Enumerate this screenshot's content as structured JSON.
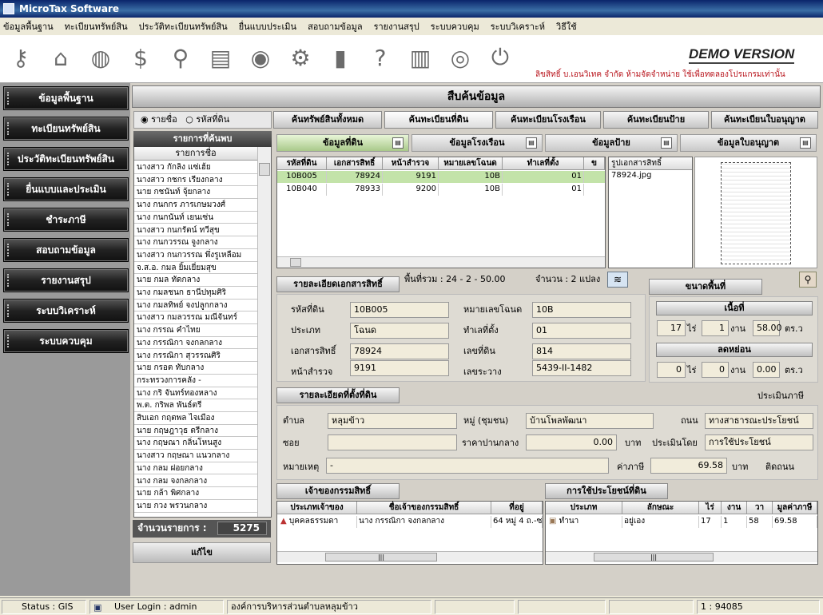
{
  "window": {
    "title": "MicroTax Software"
  },
  "menu": [
    "ข้อมูลพื้นฐาน",
    "ทะเบียนทรัพย์สิน",
    "ประวัติทะเบียนทรัพย์สิน",
    "ยื่นแบบประเมิน",
    "สอบถามข้อมูล",
    "รายงานสรุป",
    "ระบบควบคุม",
    "ระบบวิเคราะห์",
    "วิธีใช้"
  ],
  "toolbar": {
    "icons": [
      "key-icon",
      "house-icon",
      "globe-icon",
      "money-icon",
      "search-icon",
      "map-icon",
      "earth-icon",
      "gear-icon",
      "database-icon",
      "help-icon",
      "books-icon",
      "eye-icon",
      "power-icon"
    ],
    "demo": "DEMO VERSION",
    "copyright": "ลิขสิทธิ์ บ.เอนวิเทค จำกัด ห้ามจัดจำหน่าย ใช้เพื่อทดลองโปรแกรมเท่านั้น"
  },
  "nav": [
    "ข้อมูลพื้นฐาน",
    "ทะเบียนทรัพย์สิน",
    "ประวัติทะเบียนทรัพย์สิน",
    "ยื่นแบบและประเมิน",
    "ชำระภาษี",
    "สอบถามข้อมูล",
    "รายงานสรุป",
    "ระบบวิเคราะห์",
    "ระบบควบคุม"
  ],
  "main": {
    "title": "สืบค้นข้อมูล",
    "radio": {
      "opt1": "รายชื่อ",
      "opt2": "รหัสที่ดิน"
    },
    "tabs": [
      "ค้นทรัพย์สินทั้งหมด",
      "ค้นทะเบียนที่ดิน",
      "ค้นทะเบียนโรงเรือน",
      "ค้นทะเบียนป้าย",
      "ค้นทะเบียนใบอนุญาต"
    ],
    "subtabs": [
      "ข้อมูลที่ดิน",
      "ข้อมูลโรงเรือน",
      "ข้อมูลป้าย",
      "ข้อมูลใบอนุญาต"
    ]
  },
  "list": {
    "title": "รายการที่ค้นพบ",
    "col": "รายการชื่อ",
    "items": [
      "นางสาว กักลิง แซ่เฮ้ย",
      "นางสาว กชกร เรียงกลาง",
      "นาย กชนันท์ จุ้ยกลาง",
      "นาง กนกกร ภารเกษมวงศ์",
      "นาง กนกนันท์ เยนเซ่น",
      "นางสาว กนกรัตน์ ทวีสุข",
      "นาง กนกวรรณ จูงกลาง",
      "นางสาว กนกวรรณ พึ่งรูเหลือม",
      "จ.ส.อ. กมล ยิ้มเยี่ยมสุข",
      "นาย กมล ทัดกลาง",
      "นาง กมลชนก ธานีปทุมศิริ",
      "นาง กมลทิพย์ จงปลูกกลาง",
      "นางสาว กมลวรรณ มณีจันทร์",
      "นาง กรรณ คำไทย",
      "นาง กรรณิกา จงกลกลาง",
      "นาง กรรณิกา สุวรรณศิริ",
      "นาย กรอต ทับกลาง",
      "กระทรวงการคลัง -",
      "นาง กริ จันทร์ทองหลาง",
      "พ.ต. กริพล พันธ์ตรี",
      "สิบเอก กฤตพล ไจเมือง",
      "นาย กฤษฎาวุธ ตรีกลาง",
      "นาง กฤษณา กลิ่นโหนสูง",
      "นางสาว กฤษณา แนวกลาง",
      "นาง กลม ฝอยกลาง",
      "นาง กลม จงกลกลาง",
      "นาย กล้า พิศกลาง",
      "นาย กวง พรวนกลาง"
    ],
    "count_label": "จำนวนรายการ :",
    "count": "5275",
    "edit": "แก้ไข"
  },
  "landgrid": {
    "headers": [
      "รหัสที่ดิน",
      "เอกสารสิทธิ์",
      "หน้าสำรวจ",
      "หมายเลขโฉนด",
      "ทำเลที่ตั้ง",
      "ข"
    ],
    "rows": [
      [
        "10B005",
        "78924",
        "9191",
        "10B",
        "01"
      ],
      [
        "10B040",
        "78933",
        "9200",
        "10B",
        "01"
      ]
    ]
  },
  "docimg": {
    "header": "รูปเอกสารสิทธิ์",
    "file": "78924.jpg"
  },
  "area_info": {
    "label": "พื้นที่รวม :",
    "value": "24 - 2 - 50.00",
    "count_label": "จำนวน :",
    "count": "2 แปลง"
  },
  "detail": {
    "title": "รายละเอียดเอกสารสิทธิ์",
    "code_label": "รหัสที่ดิน",
    "code": "10B005",
    "type_label": "ประเภท",
    "type": "โฉนด",
    "doc_label": "เอกสารสิทธิ์",
    "doc": "78924",
    "survey_label": "หน้าสำรวจ",
    "survey": "9191",
    "deedno_label": "หมายเลขโฉนด",
    "deedno": "10B",
    "loc_label": "ทำเลที่ตั้ง",
    "loc": "01",
    "landno_label": "เลขที่ดิน",
    "landno": "814",
    "range_label": "เลขระวาง",
    "range": "5439-II-1482"
  },
  "area": {
    "title": "ขนาดพื้นที่",
    "gross": "เนื้อที่",
    "rai": "17",
    "ngan": "1",
    "wa": "58.00",
    "rai_u": "ไร่",
    "ngan_u": "งาน",
    "wa_u": "ตร.ว",
    "reduce": "ลดหย่อน",
    "r_rai": "0",
    "r_ngan": "0",
    "r_wa": "0.00"
  },
  "location": {
    "title": "รายละเอียดที่ตั้งที่ดิน",
    "assess": "ประเมินภาษี",
    "tambon_label": "ตำบล",
    "tambon": "หลุมข้าว",
    "moo_label": "หมู่ (ชุมชน)",
    "moo": "บ้านโพลพัฒนา",
    "road_label": "ถนน",
    "road": "ทางสาธารณะประโยชน์",
    "soi_label": "ซอย",
    "soi": "",
    "price_label": "ราคาปานกลาง",
    "price": "0.00",
    "baht": "บาท",
    "assessby_label": "ประเมินโดย",
    "assessby": "การใช้ประโยชน์",
    "note_label": "หมายเหตุ",
    "note": "-",
    "tax_label": "ค่าภาษี",
    "tax": "69.58",
    "baht2": "บาท",
    "road2": "ติดถนน"
  },
  "owners": {
    "title": "เจ้าของกรรมสิทธิ์",
    "headers": [
      "ประเภทเจ้าของ",
      "ชื่อเจ้าของกรรมสิทธิ์",
      "ที่อยู่"
    ],
    "rows": [
      [
        "บุคคลธรรมดา",
        "นาง กรรณิกา จงกลกลาง",
        "64 หมู่ 4 ถ.-ซ"
      ]
    ]
  },
  "usage": {
    "title": "การใช้ประโยชน์ที่ดิน",
    "headers": [
      "ประเภท",
      "ลักษณะ",
      "ไร่",
      "งาน",
      "วา",
      "มูลค่าภาษี"
    ],
    "rows": [
      [
        "ทำนา",
        "อยู่เอง",
        "17",
        "1",
        "58",
        "69.58"
      ]
    ]
  },
  "statusbar": {
    "s1": "Status : GIS",
    "s2": "User Login : admin",
    "s3": "องค์การบริหารส่วนตำบลหลุมข้าว",
    "s4": "1 : 94085"
  }
}
